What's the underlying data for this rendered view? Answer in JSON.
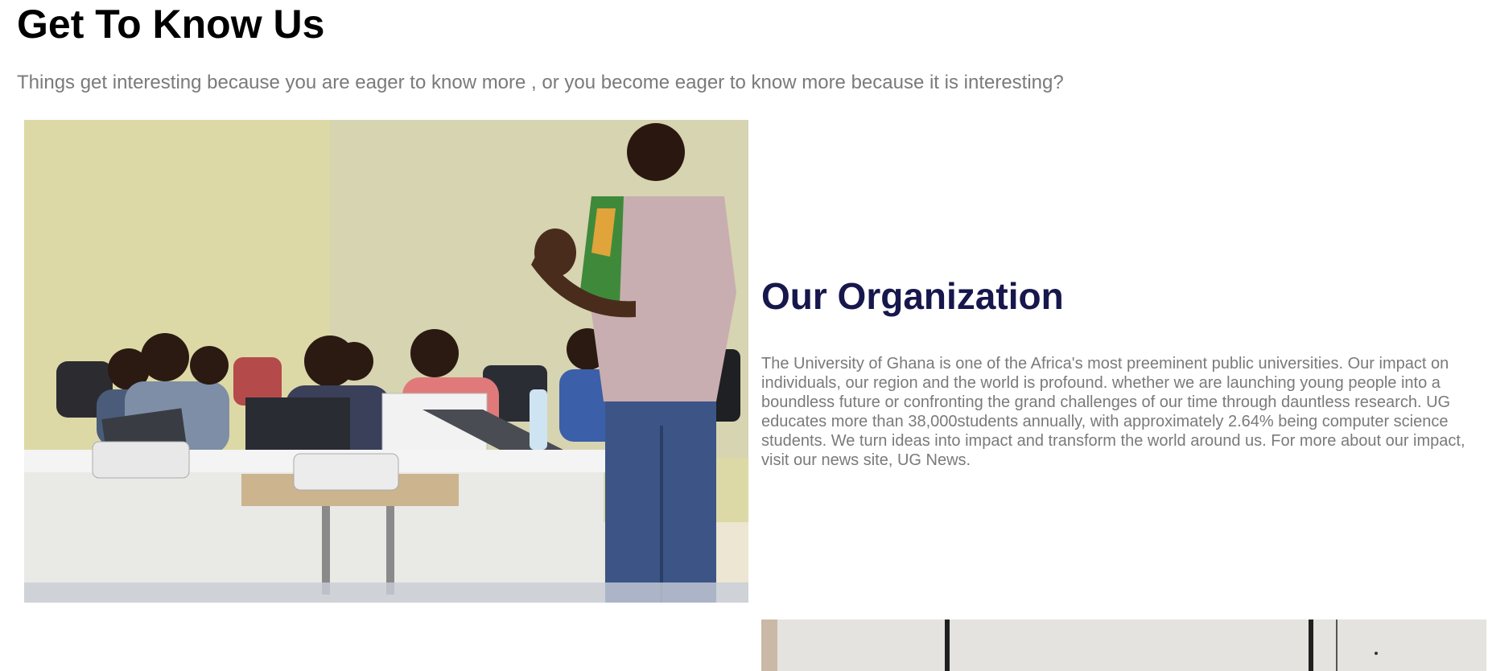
{
  "header": {
    "title": "Get To Know Us",
    "subtitle": "Things get interesting because you are eager to know more , or you become eager to know more because it is interesting?"
  },
  "organization": {
    "title": "Our Organization",
    "body": "The University of Ghana is one of the Africa's most preeminent public universities. Our impact on individuals, our region and the world is profound. whether we are launching young people into a boundless future or confronting the grand challenges of our time through dauntless research. UG educates more than 38,000students annually, with approximately 2.64% being computer science students. We turn ideas into impact and transform the world around us. For more about our impact, visit our news site, UG News."
  },
  "colors": {
    "heading": "#000000",
    "subtitle_text": "#7a7a7a",
    "org_title": "#17174d",
    "body_text": "#7a7a7a",
    "background": "#ffffff"
  }
}
